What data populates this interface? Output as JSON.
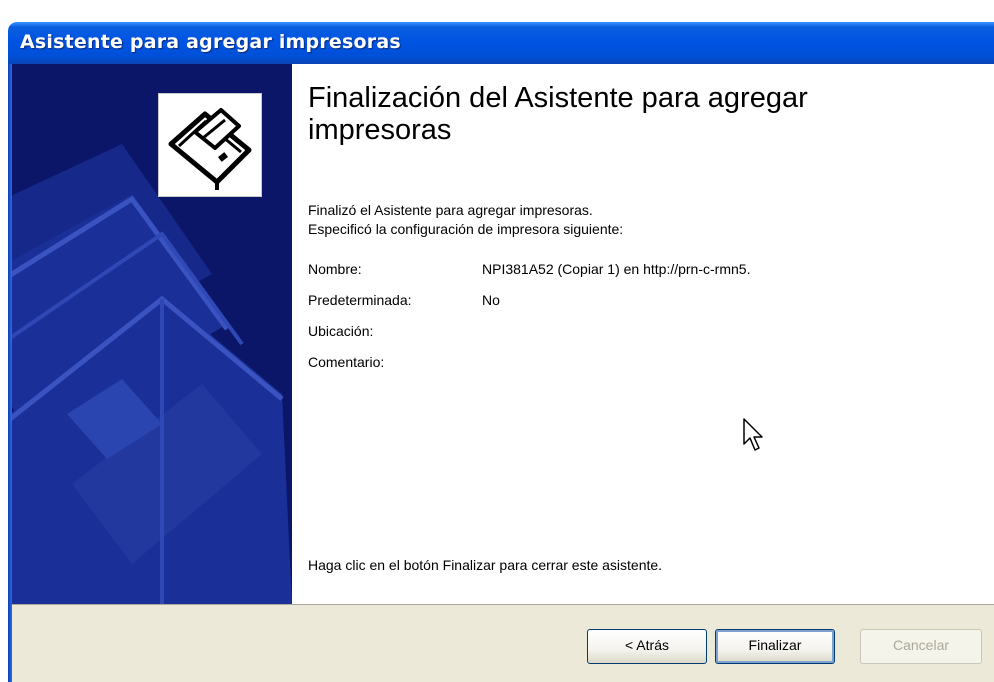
{
  "window": {
    "title": "Asistente para agregar impresoras"
  },
  "content": {
    "heading": "Finalización del Asistente para agregar impresoras",
    "intro_line1": "Finalizó el Asistente para agregar impresoras.",
    "intro_line2": "Especificó la configuración de impresora siguiente:",
    "properties": [
      {
        "label": "Nombre:",
        "value": "NPI381A52 (Copiar 1) en http://prn-c-rmn5."
      },
      {
        "label": "Predeterminada:",
        "value": "No"
      },
      {
        "label": "Ubicación:",
        "value": ""
      },
      {
        "label": "Comentario:",
        "value": ""
      }
    ],
    "footer": "Haga clic en el botón Finalizar para cerrar este asistente."
  },
  "buttons": {
    "back_label": "< Atrás",
    "finish_label": "Finalizar",
    "cancel_label": "Cancelar"
  },
  "icons": {
    "wizard": "printer-icon",
    "cursor": "mouse-pointer-icon"
  },
  "colors": {
    "titlebar": "#0054e3",
    "side_panel": "#0b1668",
    "button_area": "#ece9d8"
  }
}
